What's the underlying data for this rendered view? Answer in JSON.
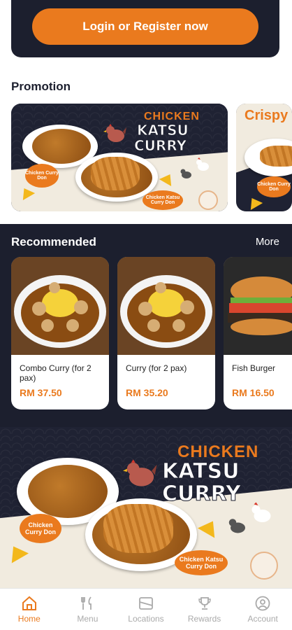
{
  "header": {
    "login_label": "Login or Register now"
  },
  "promotion": {
    "title": "Promotion",
    "banners": [
      {
        "line1": "CHICKEN",
        "line2": "KATSU",
        "line3": "CURRY",
        "tag1": "Chicken Curry Don",
        "tag2": "Chicken Katsu Curry Don"
      },
      {
        "line1": "Crispy",
        "tag1": "Chicken Curry Don"
      }
    ]
  },
  "recommended": {
    "title": "Recommended",
    "more_label": "More",
    "items": [
      {
        "name": "Combo Curry (for 2 pax)",
        "price": "RM 37.50"
      },
      {
        "name": "Curry (for 2 pax)",
        "price": "RM 35.20"
      },
      {
        "name": "Fish Burger",
        "price": "RM 16.50"
      }
    ]
  },
  "big_banner": {
    "line1": "CHICKEN",
    "line2": "KATSU",
    "line3": "CURRY",
    "tag1": "Chicken Curry Don",
    "tag2": "Chicken Katsu Curry Don"
  },
  "nav": {
    "items": [
      {
        "label": "Home",
        "icon": "home-icon"
      },
      {
        "label": "Menu",
        "icon": "fork-knife-icon"
      },
      {
        "label": "Locations",
        "icon": "map-icon"
      },
      {
        "label": "Rewards",
        "icon": "trophy-icon"
      },
      {
        "label": "Account",
        "icon": "user-icon"
      }
    ],
    "active_color": "#ea7a1e",
    "inactive_color": "#aaaaaa"
  },
  "colors": {
    "accent": "#ea7a1e",
    "dark": "#1c1f2e",
    "cream": "#f1ebdf"
  }
}
